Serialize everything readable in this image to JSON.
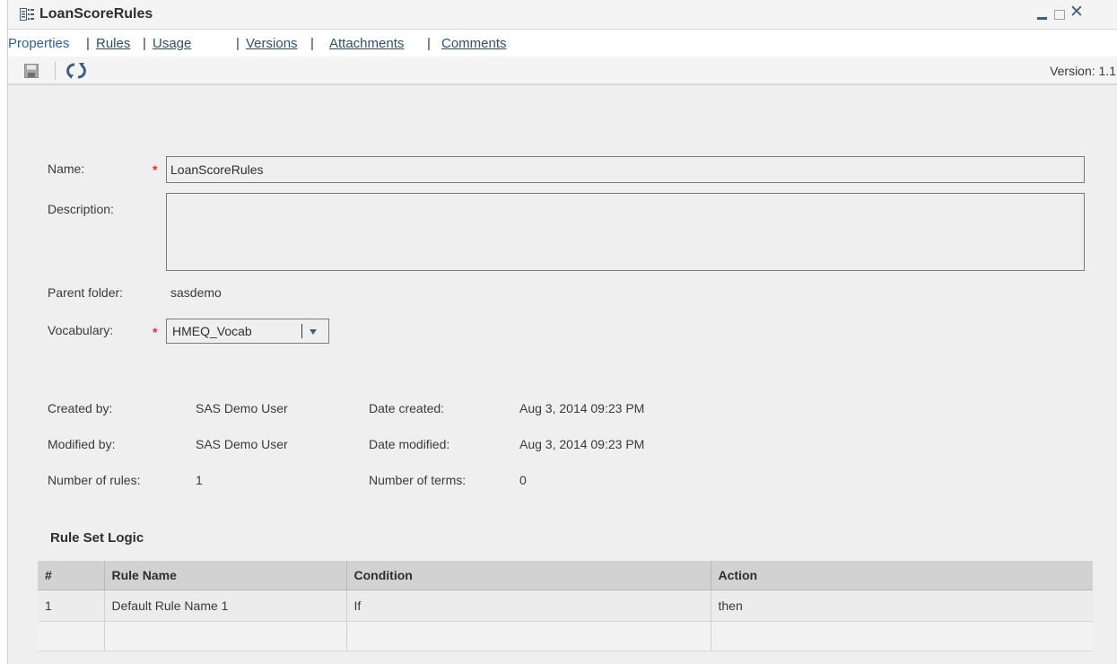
{
  "window": {
    "title": "LoanScoreRules",
    "close_glyph": "✕",
    "icons": [
      "rule-set-icon",
      "minimize-icon",
      "maximize-icon",
      "close-icon"
    ]
  },
  "tabs": [
    {
      "label": "Properties",
      "active": true
    },
    {
      "label": "Rules"
    },
    {
      "label": "Usage"
    },
    {
      "label": "Versions"
    },
    {
      "label": "Attachments"
    },
    {
      "label": "Comments"
    }
  ],
  "tab_separator": "|",
  "toolbar": {
    "icons": [
      "save-icon",
      "refresh-icon"
    ],
    "version_text": "Version: 1.1"
  },
  "form": {
    "required_marker": "*",
    "name_label": "Name:",
    "name_value": "LoanScoreRules",
    "description_label": "Description:",
    "description_value": "",
    "parent_folder_label": "Parent folder:",
    "parent_folder_value": "sasdemo",
    "vocabulary_label": "Vocabulary:",
    "vocabulary_value": "HMEQ_Vocab"
  },
  "info": {
    "created_by_label": "Created by:",
    "created_by_value": "SAS Demo User",
    "modified_by_label": "Modified by:",
    "modified_by_value": "SAS Demo User",
    "num_rules_label": "Number of rules:",
    "num_rules_value": "1",
    "date_created_label": "Date created:",
    "date_created_value": "Aug 3, 2014 09:23 PM",
    "date_modified_label": "Date modified:",
    "date_modified_value": "Aug 3, 2014 09:23 PM",
    "num_terms_label": "Number of terms:",
    "num_terms_value": "0"
  },
  "rule_set": {
    "title": "Rule Set Logic",
    "columns": [
      "#",
      "Rule Name",
      "Condition",
      "Action"
    ],
    "rows": [
      [
        "1",
        "Default Rule Name 1",
        "If",
        "then"
      ]
    ]
  },
  "colors": {
    "accent": "#3d5f86",
    "link": "#2d4f7c",
    "required": "#d9302c"
  }
}
